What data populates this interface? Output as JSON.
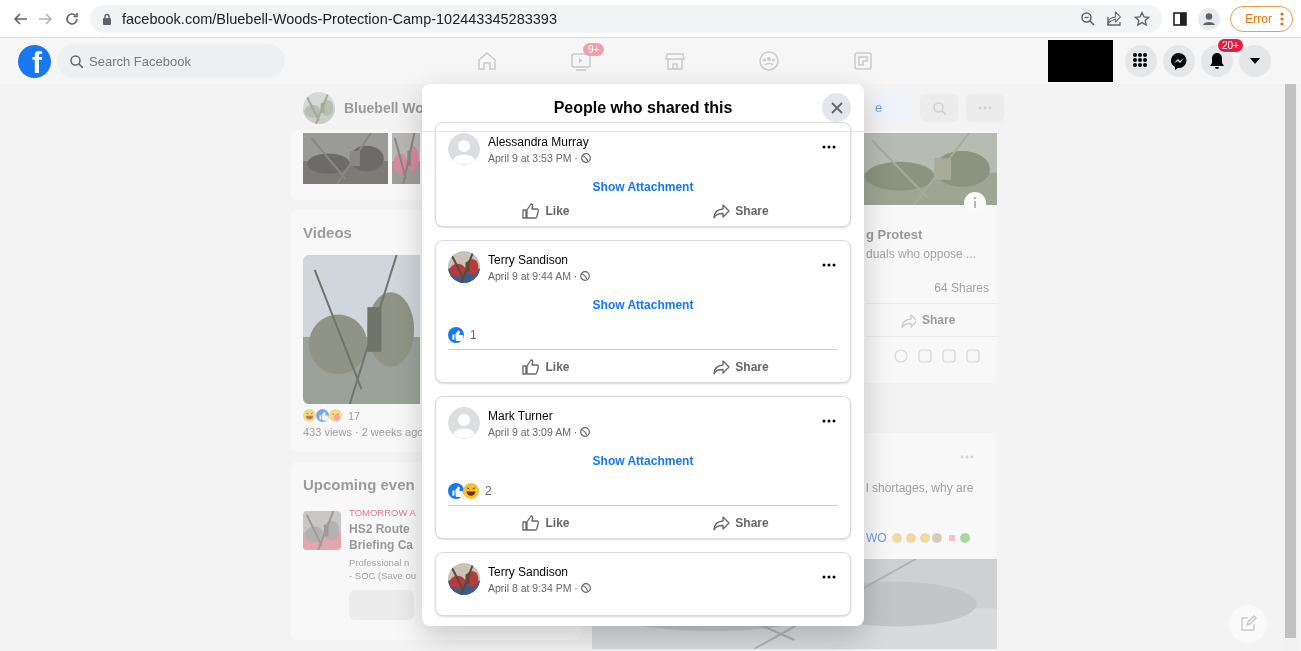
{
  "browser": {
    "url": "facebook.com/Bluebell-Woods-Protection-Camp-102443345283393",
    "profile_button": "Error"
  },
  "topbar": {
    "logo_letter": "f",
    "search": {
      "placeholder": "Search Facebook"
    },
    "nav": [
      {
        "kind": "home"
      },
      {
        "kind": "watch",
        "badge": "9+"
      },
      {
        "kind": "marketplace"
      },
      {
        "kind": "groups"
      },
      {
        "kind": "gaming"
      }
    ],
    "actions": [
      {
        "kind": "apps"
      },
      {
        "kind": "messenger"
      },
      {
        "kind": "notifications",
        "badge": "20+"
      },
      {
        "kind": "account"
      }
    ]
  },
  "page_header": {
    "name": "Bluebell Wo",
    "button_fragment": "e"
  },
  "videos": {
    "title": "Videos",
    "reactions": [
      {
        "kind": "haha"
      },
      {
        "kind": "like"
      },
      {
        "kind": "care"
      }
    ],
    "reaction_count": "17",
    "meta": "433 views · 2 weeks ago"
  },
  "events": {
    "title": "Upcoming even",
    "items": [
      {
        "date": "TOMORROW A",
        "title_lines": [
          "HS2 Route",
          "Briefing Ca"
        ],
        "description_lines": [
          "Professional n",
          "- SOC (Save ou"
        ]
      }
    ]
  },
  "right_posts": [
    {
      "kind": "shared",
      "title": "g Protest",
      "subtitle": "duals who oppose ...",
      "shares": "64 Shares",
      "action": "Share"
    },
    {
      "kind": "text",
      "text": "l shortages, why are",
      "tag": "WO"
    }
  ],
  "dialog": {
    "title": "People who shared this",
    "shares": [
      {
        "name": "Alessandra Murray",
        "avatar": {
          "kind": "placeholder"
        },
        "time": "April 9 at 3:53 PM ·",
        "attachment": "Show Attachment",
        "actions": [
          "Like",
          "Share"
        ]
      },
      {
        "name": "Terry Sandison",
        "avatar": {
          "kind": "picture"
        },
        "time": "April 9 at 9:44 AM ·",
        "attachment": "Show Attachment",
        "reactions": [
          {
            "kind": "like"
          }
        ],
        "reaction_count": "1",
        "actions": [
          "Like",
          "Share"
        ]
      },
      {
        "name": "Mark Turner",
        "avatar": {
          "kind": "placeholder"
        },
        "time": "April 9 at 3:09 AM ·",
        "attachment": "Show Attachment",
        "reactions": [
          {
            "kind": "like"
          },
          {
            "kind": "haha"
          }
        ],
        "reaction_count": "2",
        "actions": [
          "Like",
          "Share"
        ]
      },
      {
        "name": "Terry Sandison",
        "avatar": {
          "kind": "picture"
        },
        "time": "April 8 at 9:34 PM ·"
      }
    ]
  }
}
